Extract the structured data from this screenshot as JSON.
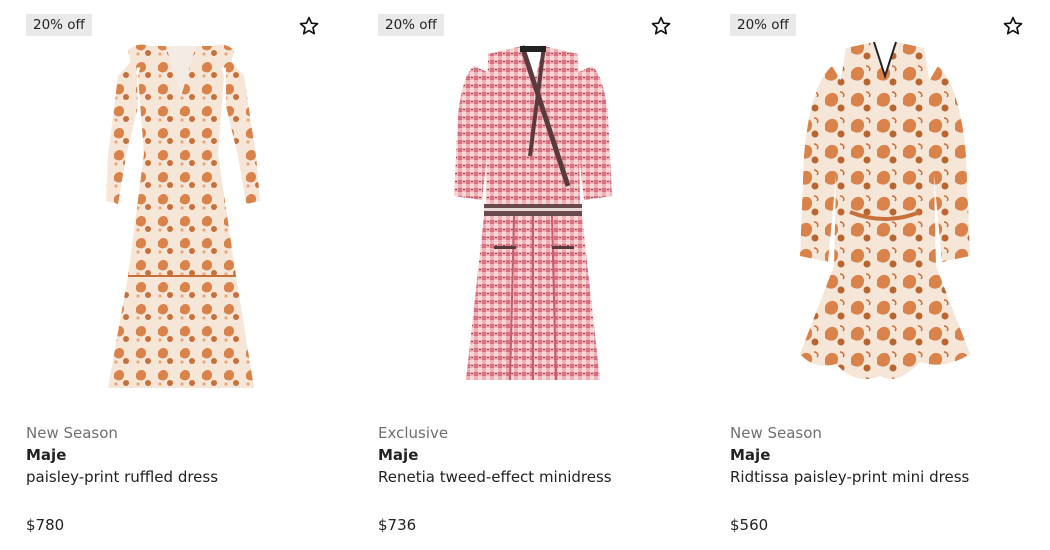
{
  "products": [
    {
      "badge": "20% off",
      "label": "New Season",
      "brand": "Maje",
      "description": "paisley-print ruffled dress",
      "price": "$780",
      "image": "orange paisley maxi dress with ruffled shoulders"
    },
    {
      "badge": "20% off",
      "label": "Exclusive",
      "brand": "Maje",
      "description": "Renetia tweed-effect minidress",
      "price": "$736",
      "image": "pink tweed wrap minidress"
    },
    {
      "badge": "20% off",
      "label": "New Season",
      "brand": "Maje",
      "description": "Ridtissa paisley-print mini dress",
      "price": "$560",
      "image": "orange paisley mini dress with long sleeves"
    }
  ],
  "icons": {
    "favourite": "star-outline-icon"
  },
  "colors": {
    "badge_bg": "#e9e9e9",
    "label_text": "#6f6f6f",
    "text": "#222222",
    "paisley_orange": "#d9824a",
    "tweed_pink": "#e58f9a"
  }
}
